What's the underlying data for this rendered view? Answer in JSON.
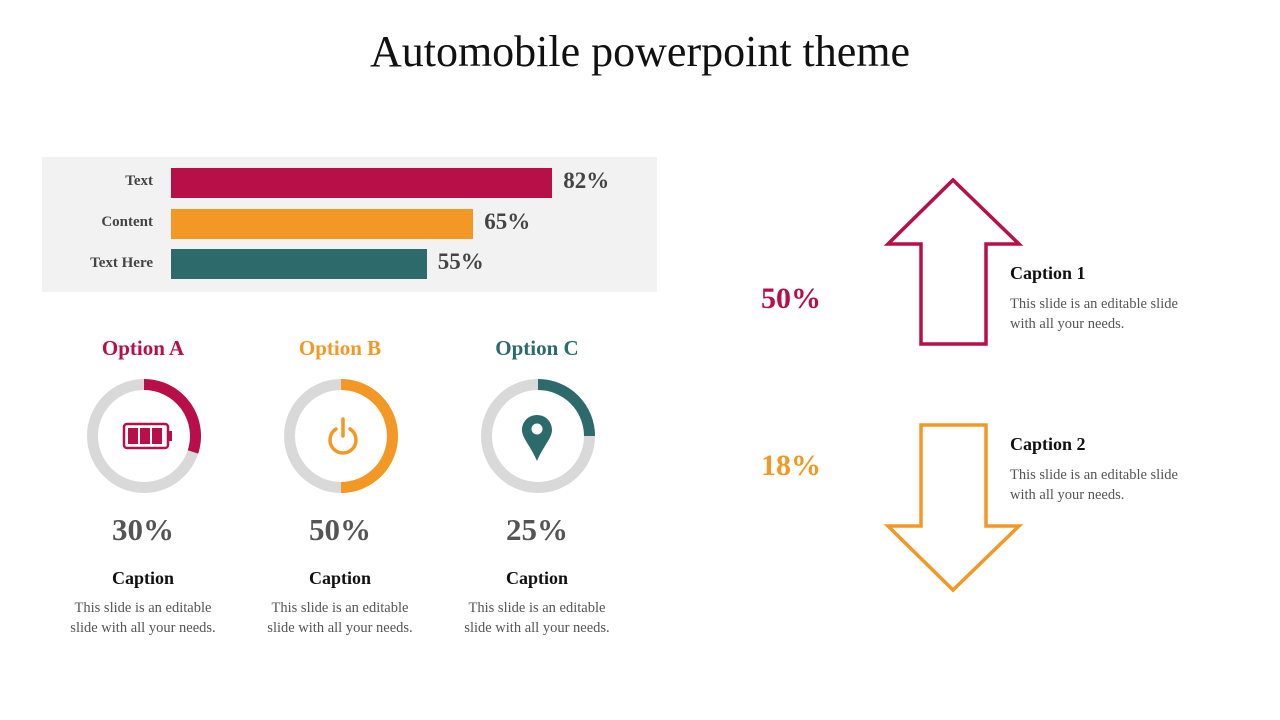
{
  "title": "Automobile powerpoint theme",
  "colors": {
    "crimson": "#b80f48",
    "orange": "#f39824",
    "teal": "#2c6a6c",
    "track": "#d9d9d9",
    "panel": "#f2f2f2"
  },
  "bars": [
    {
      "label": "Text",
      "value": 82,
      "value_label": "82%",
      "color": "#b80f48"
    },
    {
      "label": "Content",
      "value": 65,
      "value_label": "65%",
      "color": "#f39824"
    },
    {
      "label": "Text Here",
      "value": 55,
      "value_label": "55%",
      "color": "#2c6a6c"
    }
  ],
  "options": [
    {
      "title": "Option A",
      "percent": 30,
      "percent_label": "30%",
      "color": "#b80f48",
      "icon": "battery-icon",
      "caption": "Caption",
      "desc_line1": "This slide is an editable",
      "desc_line2": "slide with all your needs."
    },
    {
      "title": "Option B",
      "percent": 50,
      "percent_label": "50%",
      "color": "#f39824",
      "icon": "power-icon",
      "caption": "Caption",
      "desc_line1": "This slide is an editable",
      "desc_line2": "slide with all your needs."
    },
    {
      "title": "Option C",
      "percent": 25,
      "percent_label": "25%",
      "color": "#2c6a6c",
      "icon": "map-pin-icon",
      "caption": "Caption",
      "desc_line1": "This slide is an editable",
      "desc_line2": "slide with all your needs."
    }
  ],
  "arrows": [
    {
      "direction": "up",
      "percent_label": "50%",
      "color": "#b80f48",
      "caption": "Caption 1",
      "desc_line1": "This slide is an editable slide",
      "desc_line2": "with all your needs."
    },
    {
      "direction": "down",
      "percent_label": "18%",
      "color": "#f39824",
      "caption": "Caption 2",
      "desc_line1": "This slide is an editable slide",
      "desc_line2": "with all your needs."
    }
  ]
}
